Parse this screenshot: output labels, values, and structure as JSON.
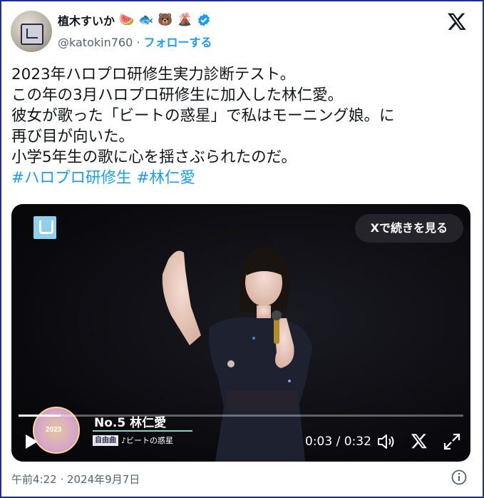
{
  "author": {
    "display_name": "植木すいか",
    "emojis": [
      "🍉",
      "🐟",
      "🐻",
      "🌋"
    ],
    "handle": "@katokin760",
    "separator": "·",
    "follow_label": "フォローする"
  },
  "tweet": {
    "lines": [
      "2023年ハロプロ研修生実力診断テスト。",
      "この年の3月ハロプロ研修生に加入した林仁愛。",
      "彼女が歌った「ビートの惑星」で私はモーニング娘。に",
      "再び目が向いた。",
      "小学5年生の歌に心を揺さぶられたのだ。"
    ],
    "hashtags": [
      "#ハロプロ研修生",
      "#林仁愛"
    ]
  },
  "video": {
    "continue_label": "Xで続きを見る",
    "caption_name": "No.5 林仁愛",
    "caption_tag": "自由曲",
    "caption_song": "♪ビートの惑星",
    "badge_year": "2023",
    "time_display": "0:03 / 0:32",
    "progress_fraction": 0.094
  },
  "footer": {
    "timestamp": "午前4:22 · 2024年9月7日"
  },
  "colors": {
    "accent": "#1d9bf0",
    "border": "#1f2f86",
    "text": "#0f1419",
    "muted": "#536471"
  },
  "icons": {
    "x_logo": "x-logo-icon",
    "verified": "verified-badge-icon",
    "play": "play-icon",
    "volume": "volume-icon",
    "fullscreen": "fullscreen-icon",
    "info": "info-icon"
  }
}
